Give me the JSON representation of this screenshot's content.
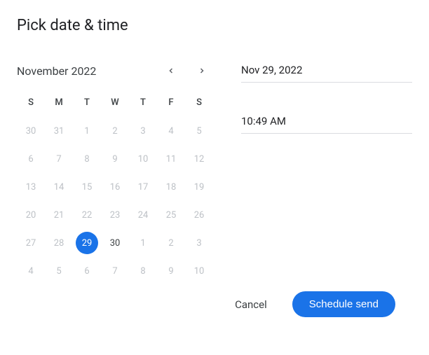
{
  "title": "Pick date & time",
  "calendar": {
    "month_label": "November 2022",
    "weekdays": [
      "S",
      "M",
      "T",
      "W",
      "T",
      "F",
      "S"
    ],
    "days": [
      {
        "n": 30,
        "out": true
      },
      {
        "n": 31,
        "out": true
      },
      {
        "n": 1,
        "out": true
      },
      {
        "n": 2,
        "out": true
      },
      {
        "n": 3,
        "out": true
      },
      {
        "n": 4,
        "out": true
      },
      {
        "n": 5,
        "out": true
      },
      {
        "n": 6,
        "out": true
      },
      {
        "n": 7,
        "out": true
      },
      {
        "n": 8,
        "out": true
      },
      {
        "n": 9,
        "out": true
      },
      {
        "n": 10,
        "out": true
      },
      {
        "n": 11,
        "out": true
      },
      {
        "n": 12,
        "out": true
      },
      {
        "n": 13,
        "out": true
      },
      {
        "n": 14,
        "out": true
      },
      {
        "n": 15,
        "out": true
      },
      {
        "n": 16,
        "out": true
      },
      {
        "n": 17,
        "out": true
      },
      {
        "n": 18,
        "out": true
      },
      {
        "n": 19,
        "out": true
      },
      {
        "n": 20,
        "out": true
      },
      {
        "n": 21,
        "out": true
      },
      {
        "n": 22,
        "out": true
      },
      {
        "n": 23,
        "out": true
      },
      {
        "n": 24,
        "out": true
      },
      {
        "n": 25,
        "out": true
      },
      {
        "n": 26,
        "out": true
      },
      {
        "n": 27,
        "out": true
      },
      {
        "n": 28,
        "out": true
      },
      {
        "n": 29,
        "selected": true
      },
      {
        "n": 30
      },
      {
        "n": 1,
        "out": true
      },
      {
        "n": 2,
        "out": true
      },
      {
        "n": 3,
        "out": true
      },
      {
        "n": 4,
        "out": true
      },
      {
        "n": 5,
        "out": true
      },
      {
        "n": 6,
        "out": true
      },
      {
        "n": 7,
        "out": true
      },
      {
        "n": 8,
        "out": true
      },
      {
        "n": 9,
        "out": true
      },
      {
        "n": 10,
        "out": true
      }
    ]
  },
  "fields": {
    "date_value": "Nov 29, 2022",
    "time_value": "10:49 AM"
  },
  "actions": {
    "cancel_label": "Cancel",
    "submit_label": "Schedule send"
  }
}
